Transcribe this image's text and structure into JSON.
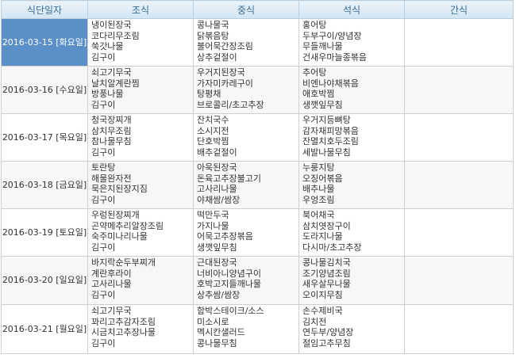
{
  "headers": {
    "date": "식단일자",
    "breakfast": "조식",
    "lunch": "중식",
    "dinner": "석식",
    "snack": "간식"
  },
  "rows": [
    {
      "date": "2016-03-15 [화요일]",
      "breakfast": [
        "냉이된장국",
        "코다리무조림",
        "쑥갓나물",
        "김구이"
      ],
      "lunch": [
        "콩나물국",
        "닭볶음탕",
        "불어묵간장조림",
        "상추겉절이"
      ],
      "dinner": [
        "홍어탕",
        "두부구이/양념장",
        "무들깨나물",
        "건새우마늘종볶음"
      ],
      "snack": ""
    },
    {
      "date": "2016-03-16 [수요일]",
      "breakfast": [
        "쇠고기무국",
        "날치알계란찜",
        "방풍나물",
        "김구이"
      ],
      "lunch": [
        "우거지된장국",
        "가자미카레구이",
        "탕평채",
        "브로콜리/초고추장"
      ],
      "dinner": [
        "추어탕",
        "비엔나야채볶음",
        "애호박찜",
        "생깻잎무침"
      ],
      "snack": ""
    },
    {
      "date": "2016-03-17 [목요일]",
      "breakfast": [
        "청국장찌개",
        "삼치무조림",
        "참나물무침",
        "김구이"
      ],
      "lunch": [
        "잔치국수",
        "소시지전",
        "단호박찜",
        "배추겉절이"
      ],
      "dinner": [
        "우거지등뼈탕",
        "감자채피망볶음",
        "잔멸치호두조림",
        "세발나물무침"
      ],
      "snack": ""
    },
    {
      "date": "2016-03-18 [금요일]",
      "breakfast": [
        "토란탕",
        "해물완자전",
        "묵은지된장지짐",
        "김구이"
      ],
      "lunch": [
        "아욱된장국",
        "돈육고추장불고기",
        "고사리나물",
        "야채쌈/쌈장"
      ],
      "dinner": [
        "누룽지탕",
        "오징어볶음",
        "배추나물",
        "우엉조림"
      ],
      "snack": ""
    },
    {
      "date": "2016-03-19 [토요일]",
      "breakfast": [
        "우렁된장찌개",
        "곤약메추리알장조림",
        "숙주미나리나물",
        "김구이"
      ],
      "lunch": [
        "떡만두국",
        "가지나물",
        "어묵고추장볶음",
        "생깻잎무침"
      ],
      "dinner": [
        "북어채국",
        "삼치엿장구이",
        "도라지나물",
        "다시마/초고추장"
      ],
      "snack": ""
    },
    {
      "date": "2016-03-20 [일요일]",
      "breakfast": [
        "바지락순두부찌개",
        "계란후라이",
        "고사리나물",
        "김구이"
      ],
      "lunch": [
        "근대된장국",
        "너비아니양념구이",
        "호박고지들깨나물",
        "상추쌈/쌈장"
      ],
      "dinner": [
        "콩나물김치국",
        "조기양념조림",
        "새우살무나물",
        "오이지무침"
      ],
      "snack": ""
    },
    {
      "date": "2016-03-21 [월요일]",
      "breakfast": [
        "쇠고기무국",
        "꽈리고추감자조림",
        "시금치고추장나물",
        "김구이"
      ],
      "lunch": [
        "함박스테이크/소스",
        "미소시로",
        "멕시칸샐러드",
        "콩나물무침"
      ],
      "dinner": [
        "손수제비국",
        "김치전",
        "연두부/양념장",
        "절임고추무침"
      ],
      "snack": ""
    }
  ]
}
